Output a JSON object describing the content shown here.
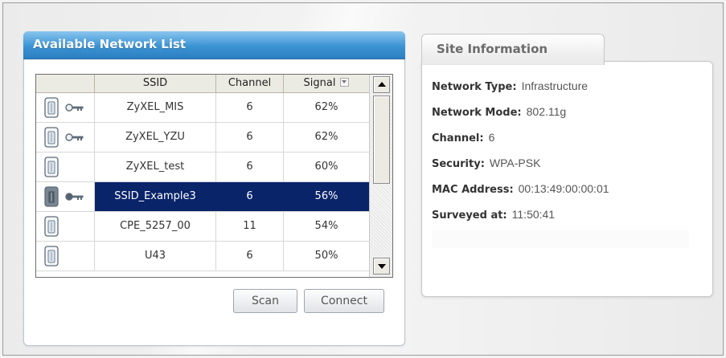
{
  "network_list": {
    "title": "Available Network List",
    "columns": {
      "icon": "",
      "ssid": "SSID",
      "channel": "Channel",
      "signal": "Signal"
    },
    "rows": [
      {
        "ssid": "ZyXEL_MIS",
        "channel": "6",
        "signal": "62%",
        "secured": true,
        "selected": false
      },
      {
        "ssid": "ZyXEL_YZU",
        "channel": "6",
        "signal": "62%",
        "secured": true,
        "selected": false
      },
      {
        "ssid": "ZyXEL_test",
        "channel": "6",
        "signal": "60%",
        "secured": false,
        "selected": false
      },
      {
        "ssid": "SSID_Example3",
        "channel": "6",
        "signal": "56%",
        "secured": true,
        "selected": true
      },
      {
        "ssid": "CPE_5257_00",
        "channel": "11",
        "signal": "54%",
        "secured": false,
        "selected": false
      },
      {
        "ssid": "U43",
        "channel": "6",
        "signal": "50%",
        "secured": false,
        "selected": false
      }
    ],
    "scan_label": "Scan",
    "connect_label": "Connect"
  },
  "site_info": {
    "title": "Site Information",
    "fields": [
      {
        "label": "Network Type:",
        "value": "Infrastructure"
      },
      {
        "label": "Network Mode:",
        "value": "802.11g"
      },
      {
        "label": "Channel:",
        "value": "6"
      },
      {
        "label": "Security:",
        "value": "WPA-PSK"
      },
      {
        "label": "MAC Address:",
        "value": "00:13:49:00:00:01"
      },
      {
        "label": "Surveyed at:",
        "value": "11:50:41"
      }
    ]
  },
  "colors": {
    "accent": "#2c7fc0",
    "selection": "#0a246a"
  },
  "icons": {
    "access_point": "access-point-icon",
    "key": "key-icon"
  }
}
